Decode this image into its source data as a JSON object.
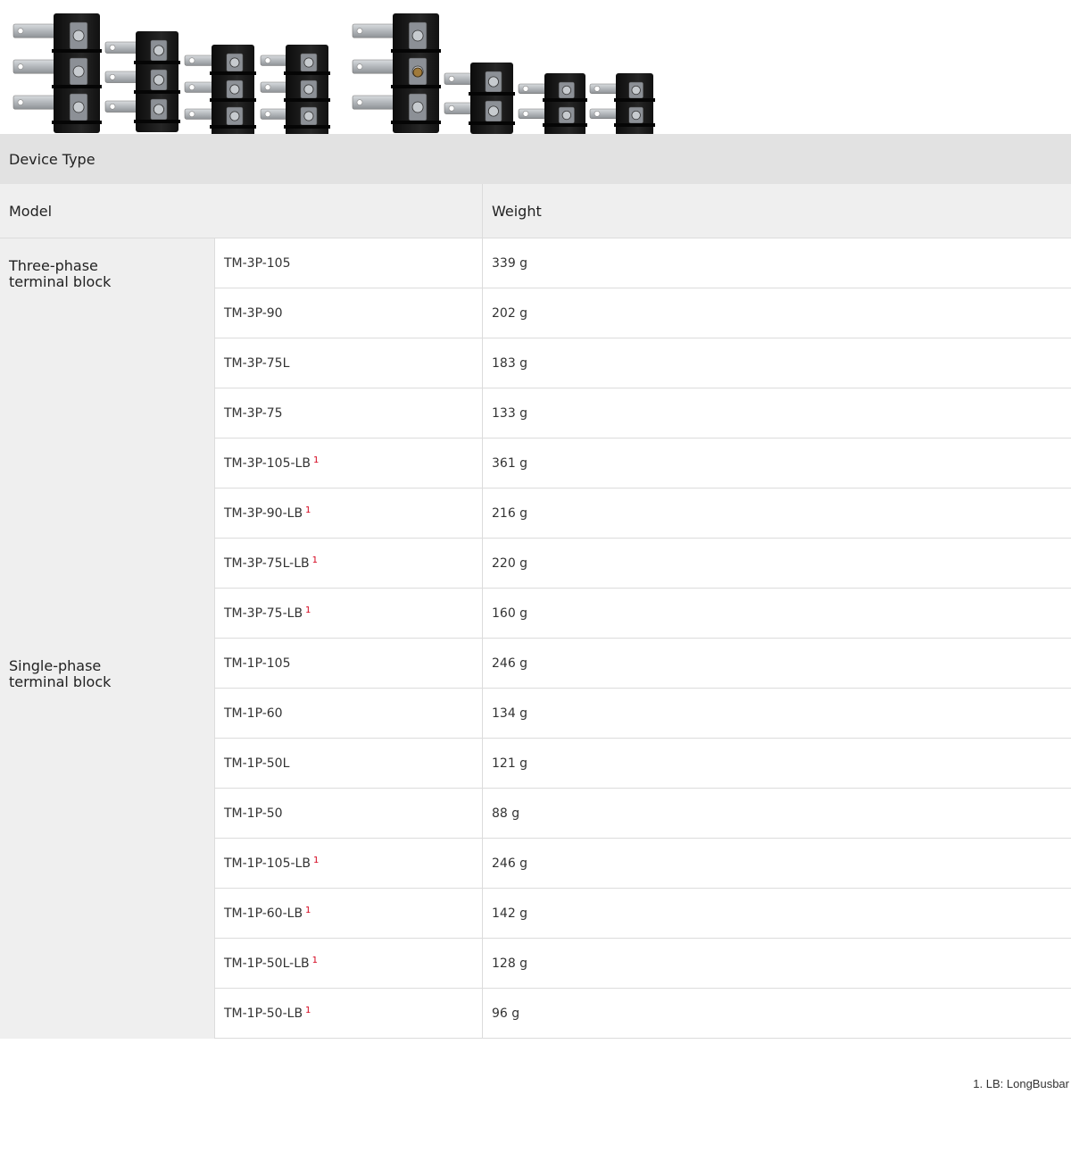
{
  "header": {
    "device_type_label": "Device Type",
    "model_label": "Model",
    "weight_label": "Weight"
  },
  "groups": [
    {
      "name_line1": "Three-phase",
      "name_line2": "terminal block",
      "rows": [
        {
          "model": "TM-3P-105",
          "note": "",
          "weight": "339 g"
        },
        {
          "model": "TM-3P-90",
          "note": "",
          "weight": "202 g"
        },
        {
          "model": "TM-3P-75L",
          "note": "",
          "weight": "183 g"
        },
        {
          "model": "TM-3P-75",
          "note": "",
          "weight": "133 g"
        },
        {
          "model": "TM-3P-105-LB",
          "note": "1",
          "weight": "361 g"
        },
        {
          "model": "TM-3P-90-LB",
          "note": "1",
          "weight": "216 g"
        },
        {
          "model": "TM-3P-75L-LB",
          "note": "1",
          "weight": "220 g"
        },
        {
          "model": "TM-3P-75-LB",
          "note": "1",
          "weight": "160 g"
        }
      ]
    },
    {
      "name_line1": "Single-phase",
      "name_line2": "terminal block",
      "rows": [
        {
          "model": "TM-1P-105",
          "note": "",
          "weight": "246 g"
        },
        {
          "model": "TM-1P-60",
          "note": "",
          "weight": "134 g"
        },
        {
          "model": "TM-1P-50L",
          "note": "",
          "weight": "121 g"
        },
        {
          "model": "TM-1P-50",
          "note": "",
          "weight": "88 g"
        },
        {
          "model": "TM-1P-105-LB",
          "note": "1",
          "weight": "246 g"
        },
        {
          "model": "TM-1P-60-LB",
          "note": "1",
          "weight": "142 g"
        },
        {
          "model": "TM-1P-50L-LB",
          "note": "1",
          "weight": "128 g"
        },
        {
          "model": "TM-1P-50-LB",
          "note": "1",
          "weight": "96 g"
        }
      ]
    }
  ],
  "footnote": "1. LB: LongBusbar",
  "colors": {
    "header_bg": "#e2e2e2",
    "label_bg": "#efefef",
    "note_red": "#d4001a",
    "block_black": "#1a1a1a",
    "busbar_silver": "#b8bcc0"
  }
}
